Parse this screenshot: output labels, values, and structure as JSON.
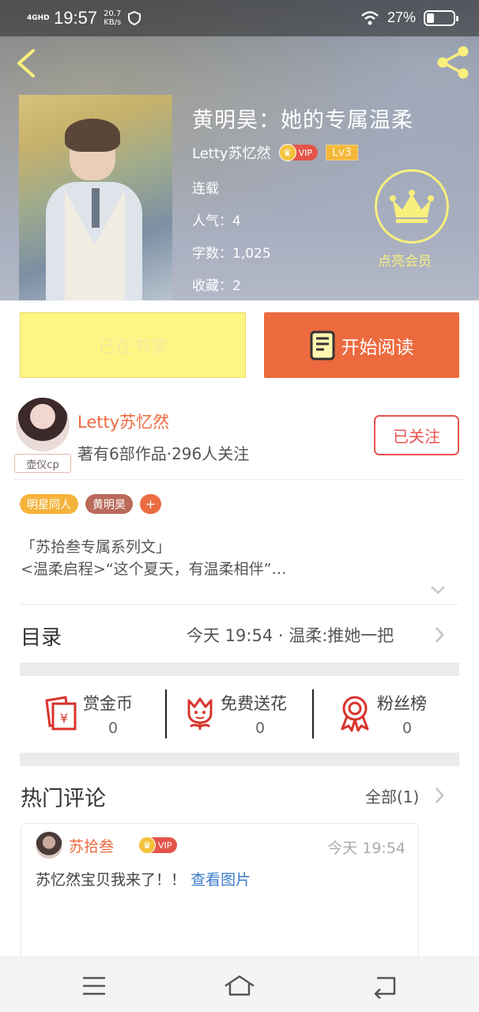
{
  "status_bar": {
    "network": "4GHD",
    "time": "19:57",
    "speed_value": "20.7",
    "speed_unit": "KB/s",
    "battery": "27%",
    "battery_level": 0.27
  },
  "header": {
    "back_icon": "chevron-left-icon",
    "share_icon": "share-icon"
  },
  "book": {
    "title": "黄明昊：她的专属温柔",
    "author": "Letty苏忆然",
    "vip_label": "VIP",
    "level": "Lv3",
    "status": "连载",
    "popularity": "人气：4",
    "word_count": "字数：1,025",
    "favorites": "收藏：2",
    "member_label": "点亮会员"
  },
  "actions": {
    "shelf_label": "已在书架",
    "read_label": "开始阅读"
  },
  "author_info": {
    "name": "Letty苏忆然",
    "stats": "著有6部作品·296人关注",
    "avatar_tag": "壶仪cp",
    "follow_label": "已关注"
  },
  "tags": [
    "明星同人",
    "黄明昊",
    "+"
  ],
  "intro": {
    "line1": "「苏拾叁专属系列文」",
    "line2": "<温柔启程>“这个夏天，有温柔相伴”…"
  },
  "toc": {
    "title": "目录",
    "latest": "今天 19:54 · 温柔:推她一把"
  },
  "stats": [
    {
      "label": "赏金币",
      "value": "0",
      "icon": "red-envelope-icon"
    },
    {
      "label": "免费送花",
      "value": "0",
      "icon": "flower-icon"
    },
    {
      "label": "粉丝榜",
      "value": "0",
      "icon": "medal-icon"
    }
  ],
  "comments_section": {
    "title": "热门评论",
    "all_label": "全部(1)"
  },
  "comment": {
    "user": "苏拾叁",
    "vip_label": "VIP",
    "time": "今天 19:54",
    "text": "苏忆然宝贝我来了！！",
    "link": "查看图片"
  },
  "nav": {
    "menu_icon": "menu-icon",
    "home_icon": "home-icon",
    "back_icon": "return-icon"
  },
  "colors": {
    "accent": "#ec6a3e",
    "shelf_button": "#fdf684",
    "follow": "#e9534e",
    "member": "#f8ef7d",
    "link": "#3a7bc8"
  }
}
